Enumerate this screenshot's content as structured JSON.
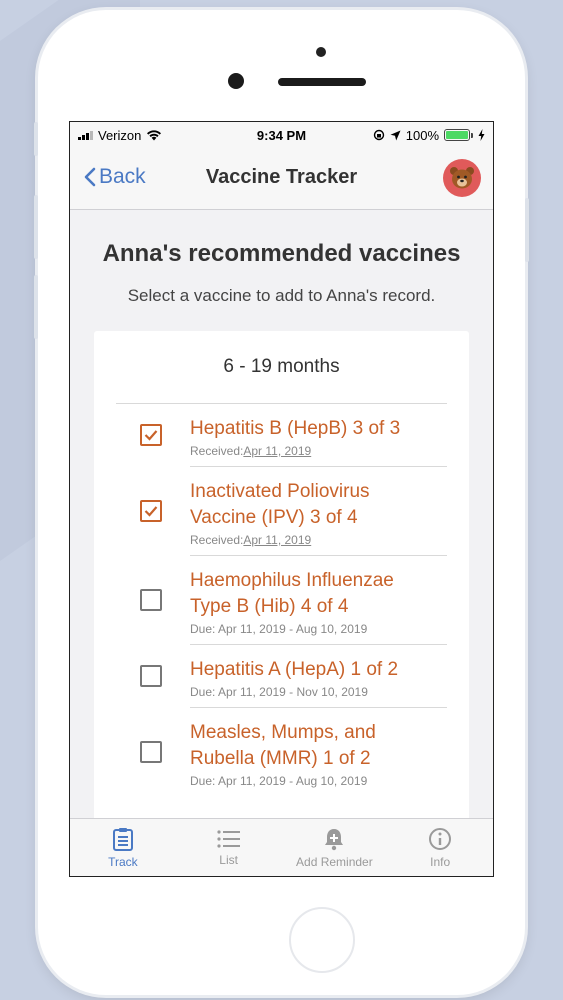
{
  "status_bar": {
    "carrier": "Verizon",
    "time": "9:34 PM",
    "battery": "100%"
  },
  "nav": {
    "back_label": "Back",
    "title": "Vaccine Tracker"
  },
  "page": {
    "heading": "Anna's recommended vaccines",
    "subheading": "Select a vaccine to add to Anna's record."
  },
  "card": {
    "heading": "6 - 19 months",
    "vaccines": [
      {
        "name": "Hepatitis B (HepB) 3 of 3",
        "meta_prefix": "Received:",
        "meta_date": "Apr 11, 2019",
        "checked": true
      },
      {
        "name": "Inactivated Poliovirus Vaccine (IPV) 3 of 4",
        "meta_prefix": "Received:",
        "meta_date": "Apr 11, 2019",
        "checked": true
      },
      {
        "name": "Haemophilus Influenzae Type B (Hib) 4 of 4",
        "meta_prefix": "Due: Apr 11, 2019 - Aug 10, 2019",
        "meta_date": "",
        "checked": false
      },
      {
        "name": "Hepatitis A (HepA) 1 of 2",
        "meta_prefix": "Due: Apr 11, 2019 - Nov 10, 2019",
        "meta_date": "",
        "checked": false
      },
      {
        "name": "Measles, Mumps, and Rubella (MMR) 1 of 2",
        "meta_prefix": "Due: Apr 11, 2019 - Aug 10, 2019",
        "meta_date": "",
        "checked": false
      }
    ]
  },
  "tabs": [
    {
      "label": "Track",
      "icon": "clipboard-icon",
      "active": true
    },
    {
      "label": "List",
      "icon": "list-icon",
      "active": false
    },
    {
      "label": "Add Reminder",
      "icon": "bell-plus-icon",
      "active": false
    },
    {
      "label": "Info",
      "icon": "info-icon",
      "active": false
    }
  ],
  "colors": {
    "accent_blue": "#4a79c4",
    "vaccine_orange": "#c8622a",
    "avatar_red": "#e05a5a",
    "battery_green": "#4cd964"
  }
}
